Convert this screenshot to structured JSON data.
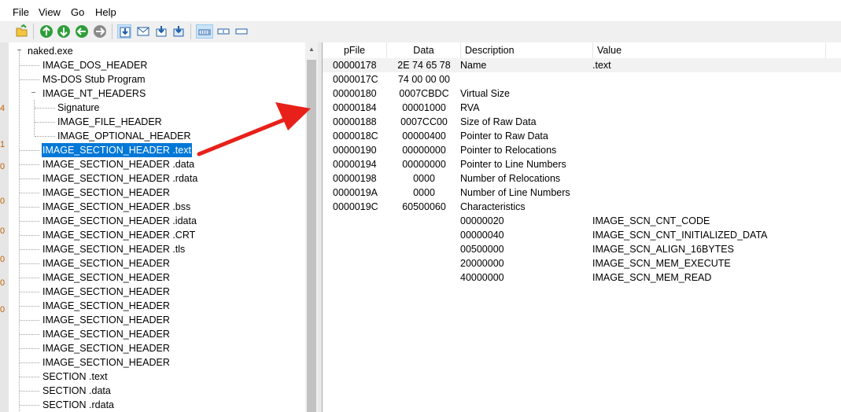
{
  "menu": {
    "items": [
      "File",
      "View",
      "Go",
      "Help"
    ]
  },
  "toolbar": {
    "buttons": [
      "open-icon",
      "back-icon",
      "forward-icon",
      "up-icon",
      "next-icon",
      "save-icon",
      "mail-icon",
      "download-icon",
      "download-alt-icon",
      "view-1-icon",
      "view-2-icon",
      "view-3-icon"
    ]
  },
  "left_strip": {
    "glyphs": [
      "4",
      "1",
      "0",
      "0",
      "0",
      "0",
      "0",
      "0"
    ]
  },
  "tree": {
    "items": [
      {
        "label": "naked.exe",
        "expander": "−"
      },
      {
        "label": "IMAGE_DOS_HEADER"
      },
      {
        "label": "MS-DOS Stub Program"
      },
      {
        "label": "IMAGE_NT_HEADERS",
        "expander": "−"
      },
      {
        "label": "Signature"
      },
      {
        "label": "IMAGE_FILE_HEADER"
      },
      {
        "label": "IMAGE_OPTIONAL_HEADER"
      },
      {
        "label": "IMAGE_SECTION_HEADER .text"
      },
      {
        "label": "IMAGE_SECTION_HEADER .data"
      },
      {
        "label": "IMAGE_SECTION_HEADER .rdata"
      },
      {
        "label": "IMAGE_SECTION_HEADER"
      },
      {
        "label": "IMAGE_SECTION_HEADER .bss"
      },
      {
        "label": "IMAGE_SECTION_HEADER .idata"
      },
      {
        "label": "IMAGE_SECTION_HEADER .CRT"
      },
      {
        "label": "IMAGE_SECTION_HEADER .tls"
      },
      {
        "label": "IMAGE_SECTION_HEADER"
      },
      {
        "label": "IMAGE_SECTION_HEADER"
      },
      {
        "label": "IMAGE_SECTION_HEADER"
      },
      {
        "label": "IMAGE_SECTION_HEADER"
      },
      {
        "label": "IMAGE_SECTION_HEADER"
      },
      {
        "label": "IMAGE_SECTION_HEADER"
      },
      {
        "label": "IMAGE_SECTION_HEADER"
      },
      {
        "label": "IMAGE_SECTION_HEADER"
      },
      {
        "label": "SECTION .text"
      },
      {
        "label": "SECTION .data"
      },
      {
        "label": "SECTION .rdata"
      }
    ],
    "selected_label": "IMAGE_SECTION_HEADER .text"
  },
  "grid": {
    "columns": [
      "pFile",
      "Data",
      "Description",
      "Value"
    ],
    "rows": [
      {
        "pfile": "00000178",
        "data": "2E  74  65  78",
        "desc": "Name",
        "value": ".text"
      },
      {
        "pfile": "0000017C",
        "data": "74  00  00  00",
        "desc": "",
        "value": ""
      },
      {
        "pfile": "00000180",
        "data": "0007CBDC",
        "desc": "Virtual Size",
        "value": ""
      },
      {
        "pfile": "00000184",
        "data": "00001000",
        "desc": "RVA",
        "value": ""
      },
      {
        "pfile": "00000188",
        "data": "0007CC00",
        "desc": "Size of Raw Data",
        "value": ""
      },
      {
        "pfile": "0000018C",
        "data": "00000400",
        "desc": "Pointer to Raw Data",
        "value": ""
      },
      {
        "pfile": "00000190",
        "data": "00000000",
        "desc": "Pointer to Relocations",
        "value": ""
      },
      {
        "pfile": "00000194",
        "data": "00000000",
        "desc": "Pointer to Line Numbers",
        "value": ""
      },
      {
        "pfile": "00000198",
        "data": "0000",
        "desc": "Number of Relocations",
        "value": ""
      },
      {
        "pfile": "0000019A",
        "data": "0000",
        "desc": "Number of Line Numbers",
        "value": ""
      },
      {
        "pfile": "0000019C",
        "data": "60500060",
        "desc": "Characteristics",
        "value": ""
      },
      {
        "pfile": "",
        "data": "",
        "desc": "00000020",
        "value": "IMAGE_SCN_CNT_CODE"
      },
      {
        "pfile": "",
        "data": "",
        "desc": "00000040",
        "value": "IMAGE_SCN_CNT_INITIALIZED_DATA"
      },
      {
        "pfile": "",
        "data": "",
        "desc": "00500000",
        "value": "IMAGE_SCN_ALIGN_16BYTES"
      },
      {
        "pfile": "",
        "data": "",
        "desc": "20000000",
        "value": "IMAGE_SCN_MEM_EXECUTE"
      },
      {
        "pfile": "",
        "data": "",
        "desc": "40000000",
        "value": "IMAGE_SCN_MEM_READ"
      }
    ]
  },
  "colors": {
    "selection": "#0078d7",
    "annotation_arrow": "#e8201a",
    "toolbar_green": "#2e9e3a"
  }
}
